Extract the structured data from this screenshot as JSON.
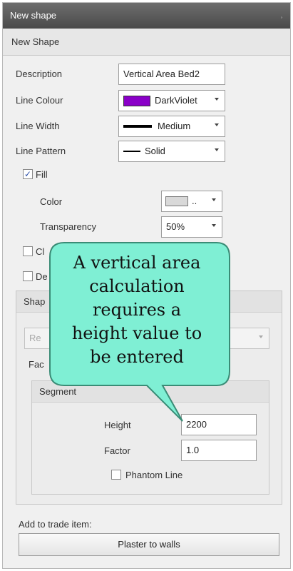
{
  "window": {
    "title": "New shape"
  },
  "header": {
    "title": "New Shape"
  },
  "form": {
    "description_label": "Description",
    "description_value": "Vertical Area Bed2",
    "line_colour_label": "Line Colour",
    "line_colour_value": "DarkViolet",
    "line_width_label": "Line Width",
    "line_width_value": "Medium",
    "line_pattern_label": "Line Pattern",
    "line_pattern_value": "Solid",
    "fill_label": "Fill",
    "color_label": "Color",
    "color_value": "..",
    "transparency_label": "Transparency",
    "transparency_value": "50%",
    "check2_label": "Cl",
    "check3_label": "De"
  },
  "shape_group": {
    "title": "Shap",
    "combo_placeholder": "Re",
    "factor_label": "Fac"
  },
  "segment": {
    "title": "Segment",
    "height_label": "Height",
    "height_value": "2200",
    "factor_label": "Factor",
    "factor_value": "1.0",
    "phantom_label": "Phantom Line"
  },
  "trade": {
    "label": "Add to trade item:",
    "button": "Plaster to walls"
  },
  "callout": {
    "line1": "A vertical area",
    "line2": "calculation",
    "line3": "requires a",
    "line4": "height value to",
    "line5": "be entered"
  },
  "colors": {
    "swatch": "#8a00c8",
    "callout_fill": "#7fefd4",
    "title_bar": "#5a5a5a"
  },
  "icons": {
    "pin": "pin-icon",
    "dropdown": "chevron-down-icon",
    "check": "check-icon"
  }
}
